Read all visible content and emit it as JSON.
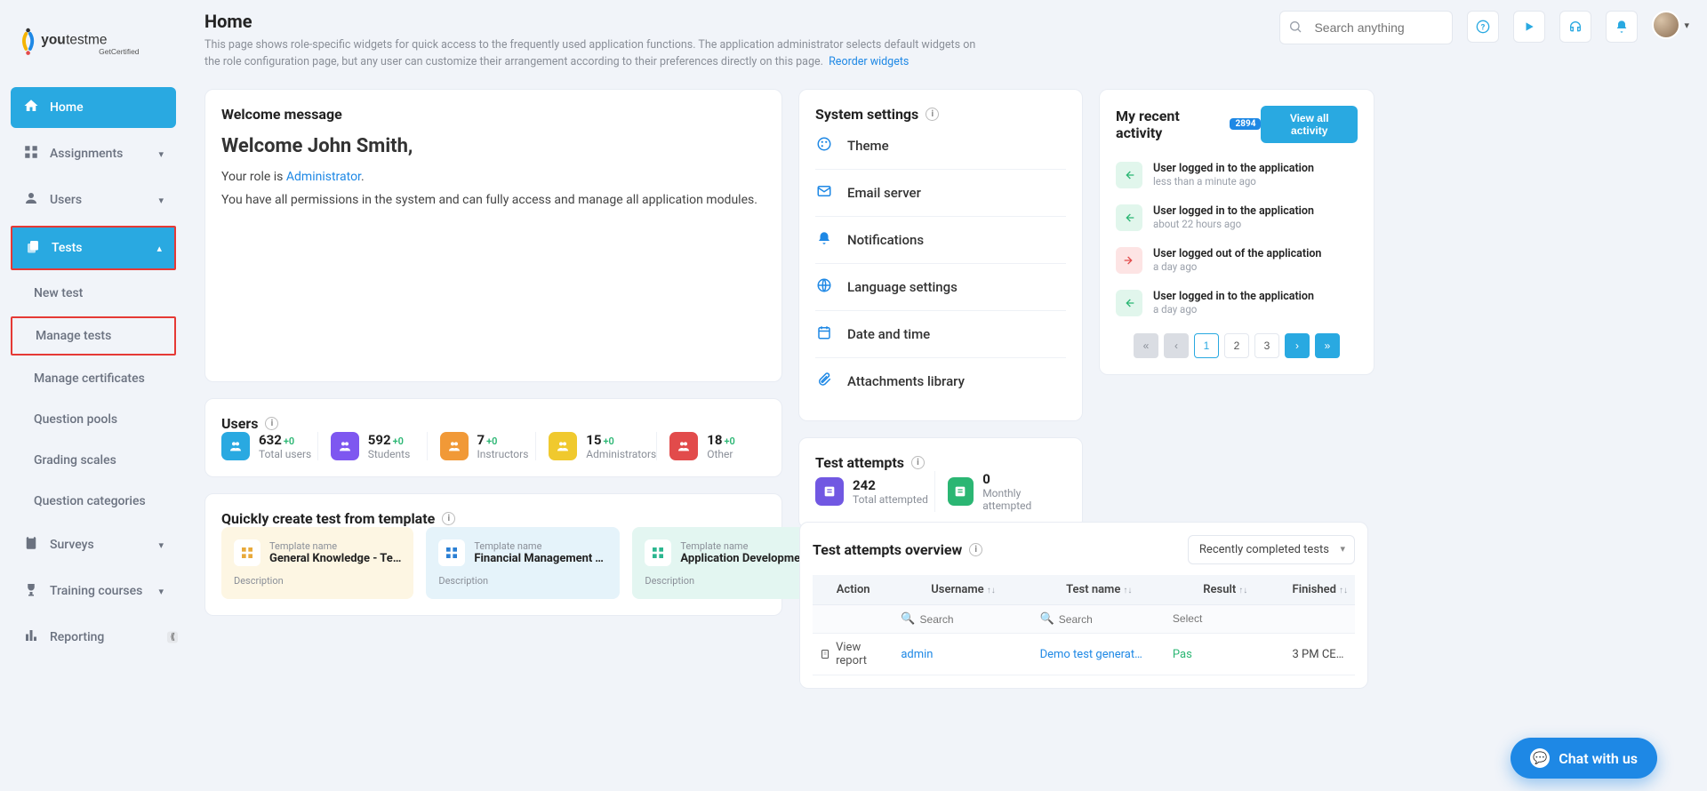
{
  "logo": {
    "brand": "youtestme",
    "sub": "GetCertified"
  },
  "sidebar": {
    "items": [
      {
        "label": "Home",
        "icon": "home"
      },
      {
        "label": "Assignments",
        "icon": "grid"
      },
      {
        "label": "Users",
        "icon": "user"
      },
      {
        "label": "Tests",
        "icon": "copy",
        "expanded": true,
        "children": [
          {
            "label": "New test"
          },
          {
            "label": "Manage tests",
            "highlight": true
          },
          {
            "label": "Manage certificates"
          },
          {
            "label": "Question pools"
          },
          {
            "label": "Grading scales"
          },
          {
            "label": "Question categories"
          }
        ]
      },
      {
        "label": "Surveys",
        "icon": "clipboard"
      },
      {
        "label": "Training courses",
        "icon": "trophy"
      },
      {
        "label": "Reporting",
        "icon": "chart"
      }
    ]
  },
  "header": {
    "title": "Home",
    "description": "This page shows role-specific widgets for quick access to the frequently used application functions. The application administrator selects default widgets on the role configuration page, but any user can customize their arrangement according to their preferences directly on this page.",
    "reorder": "Reorder widgets",
    "search_placeholder": "Search anything"
  },
  "welcome": {
    "title": "Welcome message",
    "greeting": "Welcome John Smith,",
    "role_prefix": "Your role is ",
    "role": "Administrator",
    "permissions": "You have all permissions in the system and can fully access and manage all application modules."
  },
  "system_settings": {
    "title": "System settings",
    "items": [
      {
        "label": "Theme",
        "icon": "palette"
      },
      {
        "label": "Email server",
        "icon": "mail"
      },
      {
        "label": "Notifications",
        "icon": "bell"
      },
      {
        "label": "Language settings",
        "icon": "globe"
      },
      {
        "label": "Date and time",
        "icon": "calendar"
      },
      {
        "label": "Attachments library",
        "icon": "attach"
      }
    ]
  },
  "recent_activity": {
    "title": "My recent activity",
    "count": "2894",
    "view_all": "View all activity",
    "items": [
      {
        "text": "User logged in to the application",
        "when": "less than a minute ago",
        "dir": "in"
      },
      {
        "text": "User logged in to the application",
        "when": "about 22 hours ago",
        "dir": "in"
      },
      {
        "text": "User logged out of the application",
        "when": "a day ago",
        "dir": "out"
      },
      {
        "text": "User logged in to the application",
        "when": "a day ago",
        "dir": "in"
      }
    ],
    "pages": [
      "1",
      "2",
      "3"
    ]
  },
  "users_card": {
    "title": "Users",
    "stats": [
      {
        "num": "632",
        "delta": "+0",
        "label": "Total users",
        "color": "#29a9e1"
      },
      {
        "num": "592",
        "delta": "+0",
        "label": "Students",
        "color": "#7e57f0"
      },
      {
        "num": "7",
        "delta": "+0",
        "label": "Instructors",
        "color": "#f19937"
      },
      {
        "num": "15",
        "delta": "+0",
        "label": "Administrators",
        "color": "#f0c92e"
      },
      {
        "num": "18",
        "delta": "+0",
        "label": "Other",
        "color": "#e24b4b"
      }
    ]
  },
  "test_attempts": {
    "title": "Test attempts",
    "stats": [
      {
        "num": "242",
        "label": "Total attempted",
        "color": "#7158e2"
      },
      {
        "num": "0",
        "label": "Monthly attempted",
        "color": "#2bb673"
      }
    ]
  },
  "templates_card": {
    "title": "Quickly create test from template",
    "tlabel": "Template name",
    "desc": "Description",
    "items": [
      {
        "name": "General Knowledge - Te…",
        "tone": "yellow"
      },
      {
        "name": "Financial Management T…",
        "tone": "blue"
      },
      {
        "name": "Application Developmen…",
        "tone": "teal"
      }
    ]
  },
  "overview": {
    "title": "Test attempts overview",
    "filter": "Recently completed tests",
    "columns": [
      "Action",
      "Username",
      "Test name",
      "Result",
      "Finished"
    ],
    "search": "Search",
    "select_placeholder": "Select",
    "rows": [
      {
        "action": "View report",
        "username": "admin",
        "testname": "Demo test generat…",
        "result": "Pas",
        "finished": "3 PM CE…"
      }
    ]
  },
  "chat": {
    "label": "Chat with us"
  }
}
